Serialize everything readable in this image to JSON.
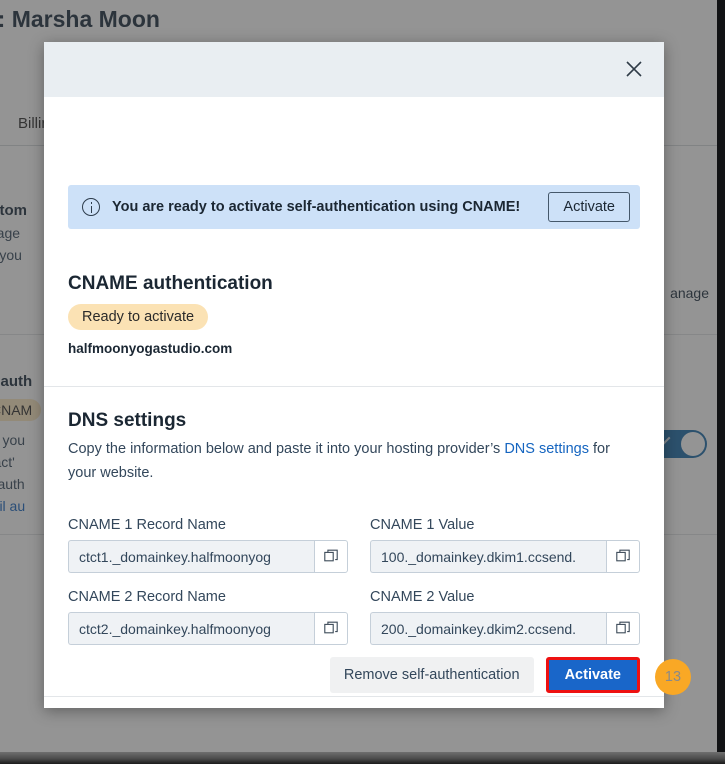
{
  "background": {
    "page_title": "t: Marsha Moon",
    "tab_billing": "Billin",
    "custom_heading": "ustom",
    "custom_line1": "lanage",
    "custom_line2": "om you",
    "manage_link": "anage",
    "self_auth_heading": "elf-auth",
    "cname_badge": "CNAM",
    "self_line1": "ave you",
    "self_line2": "ontact'",
    "self_line3": "elf-auth",
    "email_link": "mail au"
  },
  "modal": {
    "close_icon": "close-icon",
    "banner": {
      "icon": "info-icon",
      "message": "You are ready to activate self-authentication using CNAME!",
      "action_label": "Activate"
    },
    "cname_section": {
      "title": "CNAME authentication",
      "status_badge": "Ready to activate",
      "domain": "halfmoonyogastudio.com"
    },
    "dns_section": {
      "title": "DNS settings",
      "description_before": "Copy the information below and paste it into your hosting provider’s ",
      "description_link": "DNS settings",
      "description_after": " for your website.",
      "fields": [
        {
          "label": "CNAME 1 Record Name",
          "value": "ctct1._domainkey.halfmoonyog",
          "copy_icon": "copy-icon"
        },
        {
          "label": "CNAME 1 Value",
          "value": "100._domainkey.dkim1.ccsend.",
          "copy_icon": "copy-icon"
        },
        {
          "label": "CNAME 2 Record Name",
          "value": "ctct2._domainkey.halfmoonyog",
          "copy_icon": "copy-icon"
        },
        {
          "label": "CNAME 2 Value",
          "value": "200._domainkey.dkim2.ccsend.",
          "copy_icon": "copy-icon"
        }
      ]
    },
    "footer": {
      "remove_label": "Remove self-authentication",
      "activate_label": "Activate"
    }
  },
  "cursor_badge": {
    "label": "13"
  },
  "colors": {
    "modal_header": "#e9eef2",
    "banner_bg": "#cde1f8",
    "status_badge_bg": "#fbe2b4",
    "primary_button": "#1966c9",
    "highlight_outline": "#ee1111",
    "link": "#1565c0",
    "badge_bg": "#f9a825",
    "toggle_on": "#1a6aa8"
  }
}
